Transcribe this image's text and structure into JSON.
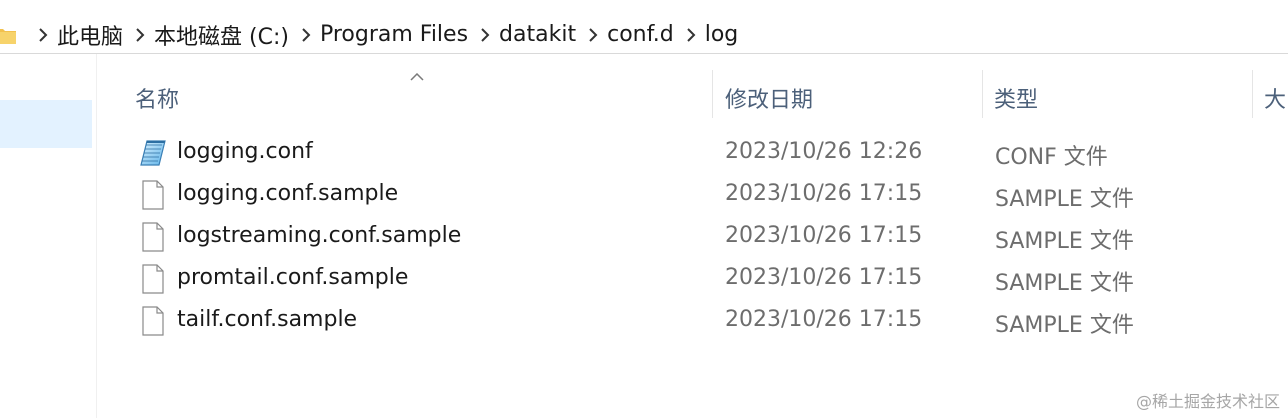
{
  "address_bar": {
    "breadcrumbs": [
      "此电脑",
      "本地磁盘 (C:)",
      "Program Files",
      "datakit",
      "conf.d",
      "log"
    ]
  },
  "columns": {
    "name": "名称",
    "modified": "修改日期",
    "type": "类型",
    "size": "大"
  },
  "files": [
    {
      "name": "logging.conf",
      "modified": "2023/10/26 12:26",
      "type": "CONF 文件",
      "icon": "notepad-file-icon"
    },
    {
      "name": "logging.conf.sample",
      "modified": "2023/10/26 17:15",
      "type": "SAMPLE 文件",
      "icon": "blank-file-icon"
    },
    {
      "name": "logstreaming.conf.sample",
      "modified": "2023/10/26 17:15",
      "type": "SAMPLE 文件",
      "icon": "blank-file-icon"
    },
    {
      "name": "promtail.conf.sample",
      "modified": "2023/10/26 17:15",
      "type": "SAMPLE 文件",
      "icon": "blank-file-icon"
    },
    {
      "name": "tailf.conf.sample",
      "modified": "2023/10/26 17:15",
      "type": "SAMPLE 文件",
      "icon": "blank-file-icon"
    }
  ],
  "watermark": "@稀土掘金技术社区",
  "colors": {
    "header_text": "#4c607a",
    "secondary_text": "#6d6d6d",
    "folder": "#f2c14e",
    "nav_selected": "#cce8ff"
  }
}
